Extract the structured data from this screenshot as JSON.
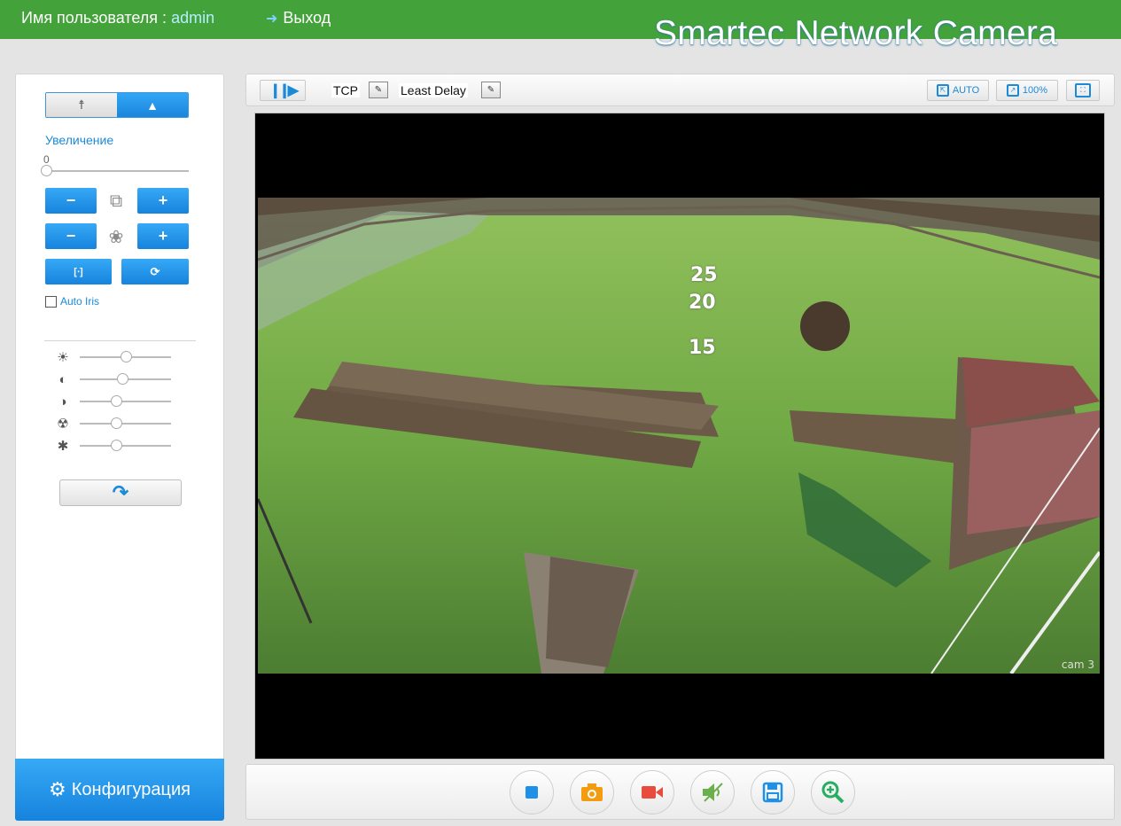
{
  "header": {
    "user_label": "Имя пользователя : ",
    "username": "admin",
    "logout_label": "Выход",
    "brand": "Smartec Network Camera"
  },
  "left_panel": {
    "zoom_label": "Увеличение",
    "zoom_value": "0",
    "zoom_minus": "−",
    "zoom_plus": "+",
    "focus_minus": "−",
    "focus_plus": "+",
    "auto_iris_label": "Auto Iris",
    "image_adjust": [
      {
        "icon": "brightness-icon",
        "level": 0.5
      },
      {
        "icon": "contrast-icon",
        "level": 0.47
      },
      {
        "icon": "saturation-icon",
        "level": 0.4
      },
      {
        "icon": "hue-icon",
        "level": 0.4
      },
      {
        "icon": "sharpness-icon",
        "level": 0.4
      }
    ],
    "config_label": "Конфигурация"
  },
  "toolbar": {
    "protocol": "TCP",
    "delay_mode": "Least Delay",
    "auto_label": "AUTO",
    "percent_label": "100%"
  },
  "video": {
    "osd_values": [
      "25",
      "20",
      "15"
    ],
    "camera_label": "cam 3"
  },
  "controls": [
    {
      "name": "stop-button",
      "icon": "stop-icon",
      "color": "#1e90e8"
    },
    {
      "name": "snapshot-button",
      "icon": "camera-icon",
      "color": "#f39c12"
    },
    {
      "name": "record-button",
      "icon": "video-record-icon",
      "color": "#e74c3c"
    },
    {
      "name": "audio-button",
      "icon": "speaker-mute-icon",
      "color": "#6ab04c"
    },
    {
      "name": "save-button",
      "icon": "floppy-icon",
      "color": "#1e90e8"
    },
    {
      "name": "digital-zoom-button",
      "icon": "zoom-in-icon",
      "color": "#27ae60"
    }
  ],
  "colors": {
    "header_green": "#44a23b",
    "accent_blue": "#1b8ad8"
  }
}
